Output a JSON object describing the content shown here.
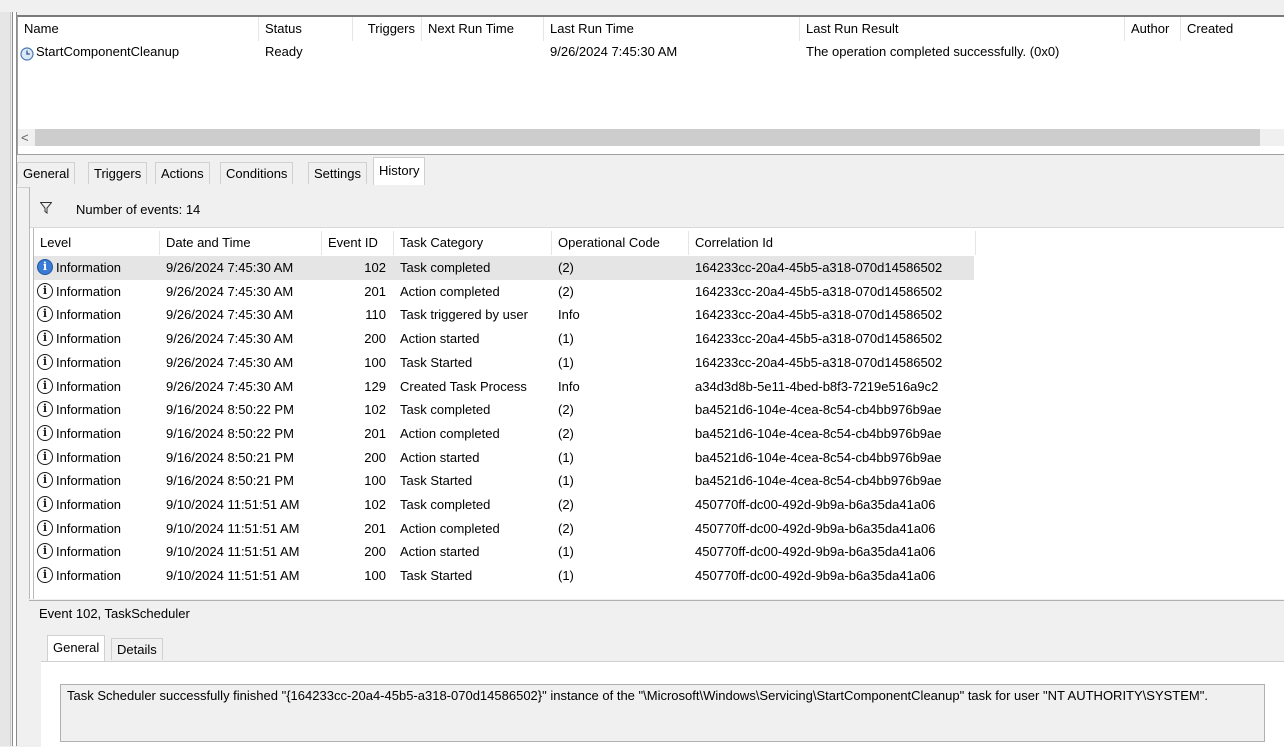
{
  "task_list": {
    "columns": [
      "Name",
      "Status",
      "Triggers",
      "Next Run Time",
      "Last Run Time",
      "Last Run Result",
      "Author",
      "Created"
    ],
    "rows": [
      {
        "name": "StartComponentCleanup",
        "status": "Ready",
        "triggers": "",
        "next_run": "",
        "last_run": "9/26/2024 7:45:30 AM",
        "last_result": "The operation completed successfully. (0x0)",
        "author": "",
        "created": ""
      }
    ],
    "icon": "clock-icon",
    "scroll_left": "<"
  },
  "tabs": [
    {
      "label": "General"
    },
    {
      "label": "Triggers"
    },
    {
      "label": "Actions"
    },
    {
      "label": "Conditions"
    },
    {
      "label": "Settings"
    },
    {
      "label": "History",
      "active": true
    }
  ],
  "history": {
    "filter_icon": "filter-icon",
    "count_text": "Number of events: 14",
    "columns": [
      "Level",
      "Date and Time",
      "Event ID",
      "Task Category",
      "Operational Code",
      "Correlation Id"
    ],
    "events": [
      {
        "level": "Information",
        "date": "9/26/2024 7:45:30 AM",
        "id": "102",
        "category": "Task completed",
        "opcode": "(2)",
        "corr": "164233cc-20a4-45b5-a318-070d14586502"
      },
      {
        "level": "Information",
        "date": "9/26/2024 7:45:30 AM",
        "id": "201",
        "category": "Action completed",
        "opcode": "(2)",
        "corr": "164233cc-20a4-45b5-a318-070d14586502"
      },
      {
        "level": "Information",
        "date": "9/26/2024 7:45:30 AM",
        "id": "110",
        "category": "Task triggered by user",
        "opcode": "Info",
        "corr": "164233cc-20a4-45b5-a318-070d14586502"
      },
      {
        "level": "Information",
        "date": "9/26/2024 7:45:30 AM",
        "id": "200",
        "category": "Action started",
        "opcode": "(1)",
        "corr": "164233cc-20a4-45b5-a318-070d14586502"
      },
      {
        "level": "Information",
        "date": "9/26/2024 7:45:30 AM",
        "id": "100",
        "category": "Task Started",
        "opcode": "(1)",
        "corr": "164233cc-20a4-45b5-a318-070d14586502"
      },
      {
        "level": "Information",
        "date": "9/26/2024 7:45:30 AM",
        "id": "129",
        "category": "Created Task Process",
        "opcode": "Info",
        "corr": "a34d3d8b-5e11-4bed-b8f3-7219e516a9c2"
      },
      {
        "level": "Information",
        "date": "9/16/2024 8:50:22 PM",
        "id": "102",
        "category": "Task completed",
        "opcode": "(2)",
        "corr": "ba4521d6-104e-4cea-8c54-cb4bb976b9ae"
      },
      {
        "level": "Information",
        "date": "9/16/2024 8:50:22 PM",
        "id": "201",
        "category": "Action completed",
        "opcode": "(2)",
        "corr": "ba4521d6-104e-4cea-8c54-cb4bb976b9ae"
      },
      {
        "level": "Information",
        "date": "9/16/2024 8:50:21 PM",
        "id": "200",
        "category": "Action started",
        "opcode": "(1)",
        "corr": "ba4521d6-104e-4cea-8c54-cb4bb976b9ae"
      },
      {
        "level": "Information",
        "date": "9/16/2024 8:50:21 PM",
        "id": "100",
        "category": "Task Started",
        "opcode": "(1)",
        "corr": "ba4521d6-104e-4cea-8c54-cb4bb976b9ae"
      },
      {
        "level": "Information",
        "date": "9/10/2024 11:51:51 AM",
        "id": "102",
        "category": "Task completed",
        "opcode": "(2)",
        "corr": "450770ff-dc00-492d-9b9a-b6a35da41a06"
      },
      {
        "level": "Information",
        "date": "9/10/2024 11:51:51 AM",
        "id": "201",
        "category": "Action completed",
        "opcode": "(2)",
        "corr": "450770ff-dc00-492d-9b9a-b6a35da41a06"
      },
      {
        "level": "Information",
        "date": "9/10/2024 11:51:51 AM",
        "id": "200",
        "category": "Action started",
        "opcode": "(1)",
        "corr": "450770ff-dc00-492d-9b9a-b6a35da41a06"
      },
      {
        "level": "Information",
        "date": "9/10/2024 11:51:51 AM",
        "id": "100",
        "category": "Task Started",
        "opcode": "(1)",
        "corr": "450770ff-dc00-492d-9b9a-b6a35da41a06"
      }
    ],
    "info_glyph": "i",
    "info_icon": "information-icon"
  },
  "detail": {
    "header": "Event 102, TaskScheduler",
    "tabs": [
      {
        "label": "General",
        "active": true
      },
      {
        "label": "Details"
      }
    ],
    "message": "Task Scheduler successfully finished \"{164233cc-20a4-45b5-a318-070d14586502}\" instance of the \"\\Microsoft\\Windows\\Servicing\\StartComponentCleanup\" task for user \"NT AUTHORITY\\SYSTEM\"."
  }
}
